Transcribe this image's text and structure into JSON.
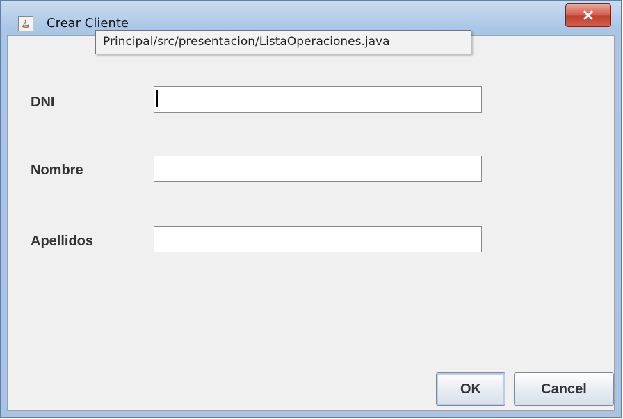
{
  "window": {
    "title": "Crear Cliente",
    "app_icon": "java-icon",
    "close_icon": "close-icon"
  },
  "tooltip": {
    "text": "Principal/src/presentacion/ListaOperaciones.java"
  },
  "form": {
    "fields": [
      {
        "label": "DNI",
        "value": ""
      },
      {
        "label": "Nombre",
        "value": ""
      },
      {
        "label": "Apellidos",
        "value": ""
      }
    ]
  },
  "buttons": {
    "ok": "OK",
    "cancel": "Cancel"
  },
  "colors": {
    "close_button": "#d0503c",
    "window_frame": "#aac6e6",
    "content_bg": "#f0f0f0"
  }
}
